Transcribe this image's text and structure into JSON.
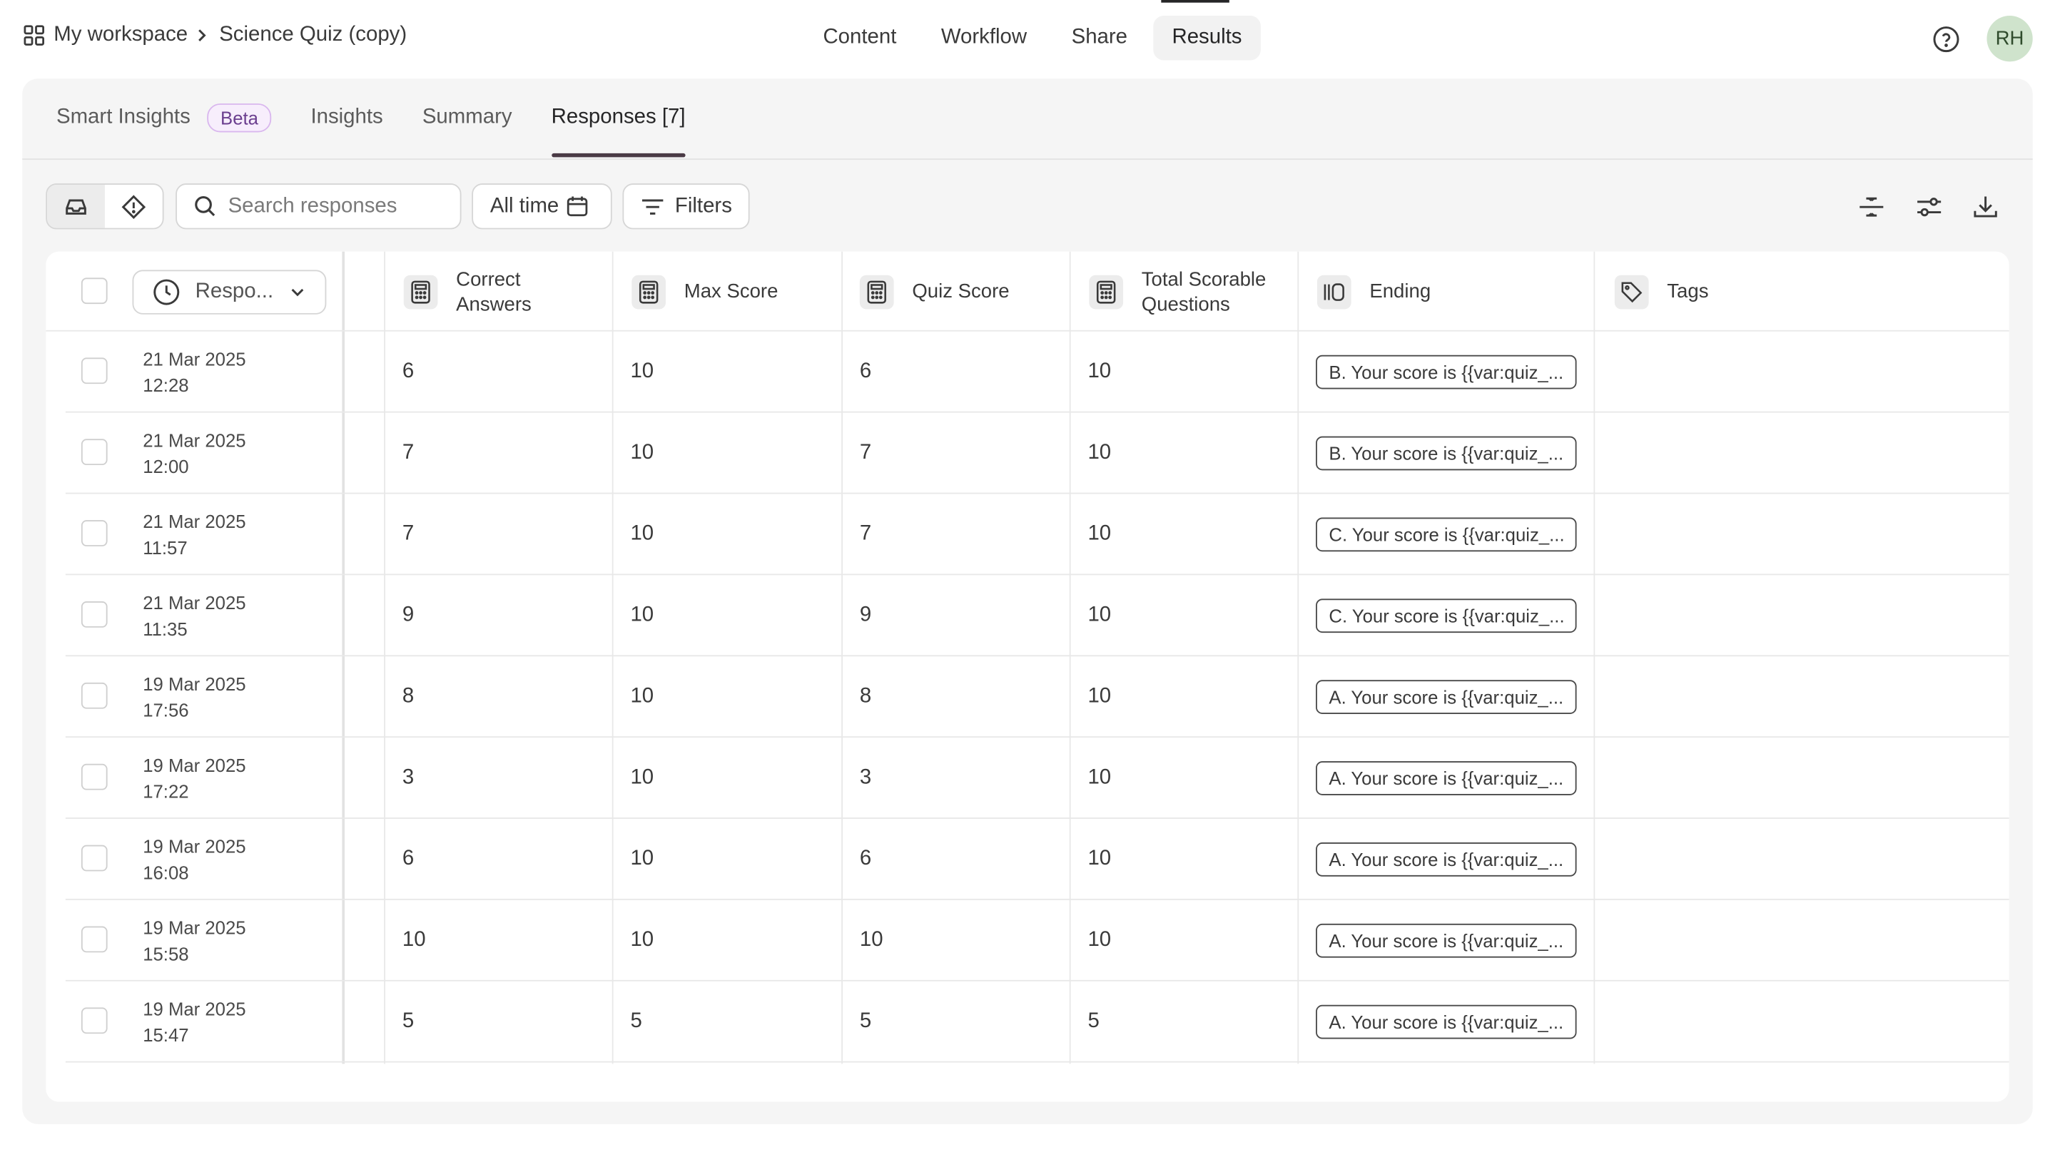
{
  "breadcrumb": {
    "workspace": "My workspace",
    "form": "Science Quiz (copy)"
  },
  "nav": {
    "items": [
      "Content",
      "Workflow",
      "Share",
      "Results"
    ],
    "active": "Results"
  },
  "user": {
    "initials": "RH"
  },
  "subtabs": {
    "smart_insights": "Smart Insights",
    "beta": "Beta",
    "insights": "Insights",
    "summary": "Summary",
    "responses": "Responses [7]"
  },
  "toolbar": {
    "search_placeholder": "Search responses",
    "time_label": "All time",
    "filters_label": "Filters"
  },
  "table": {
    "first_column": "Respo...",
    "columns": {
      "correct": "Correct Answers",
      "max": "Max Score",
      "quiz": "Quiz Score",
      "total": "Total Scorable Questions",
      "ending": "Ending",
      "tags": "Tags"
    },
    "rows": [
      {
        "date": "21 Mar 2025",
        "time": "12:28",
        "correct": "6",
        "max": "10",
        "quiz": "6",
        "total": "10",
        "ending": "B. Your score is {{var:quiz_..."
      },
      {
        "date": "21 Mar 2025",
        "time": "12:00",
        "correct": "7",
        "max": "10",
        "quiz": "7",
        "total": "10",
        "ending": "B. Your score is {{var:quiz_..."
      },
      {
        "date": "21 Mar 2025",
        "time": "11:57",
        "correct": "7",
        "max": "10",
        "quiz": "7",
        "total": "10",
        "ending": "C. Your score is {{var:quiz_..."
      },
      {
        "date": "21 Mar 2025",
        "time": "11:35",
        "correct": "9",
        "max": "10",
        "quiz": "9",
        "total": "10",
        "ending": "C. Your score is {{var:quiz_..."
      },
      {
        "date": "19 Mar 2025",
        "time": "17:56",
        "correct": "8",
        "max": "10",
        "quiz": "8",
        "total": "10",
        "ending": "A. Your score is {{var:quiz_..."
      },
      {
        "date": "19 Mar 2025",
        "time": "17:22",
        "correct": "3",
        "max": "10",
        "quiz": "3",
        "total": "10",
        "ending": "A. Your score is {{var:quiz_..."
      },
      {
        "date": "19 Mar 2025",
        "time": "16:08",
        "correct": "6",
        "max": "10",
        "quiz": "6",
        "total": "10",
        "ending": "A. Your score is {{var:quiz_..."
      },
      {
        "date": "19 Mar 2025",
        "time": "15:58",
        "correct": "10",
        "max": "10",
        "quiz": "10",
        "total": "10",
        "ending": "A. Your score is {{var:quiz_..."
      },
      {
        "date": "19 Mar 2025",
        "time": "15:47",
        "correct": "5",
        "max": "5",
        "quiz": "5",
        "total": "5",
        "ending": "A. Your score is {{var:quiz_..."
      }
    ]
  }
}
